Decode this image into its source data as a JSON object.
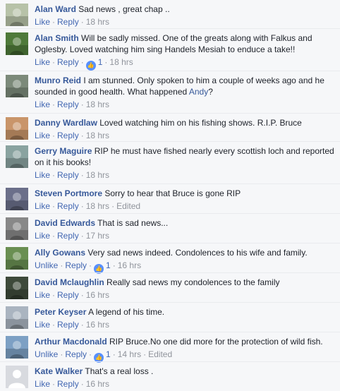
{
  "separator": "·",
  "like_icon_glyph": "👍",
  "comments": [
    {
      "name": "Alan Ward",
      "text": "Sad news , great chap ..",
      "action": "Like",
      "reply": "Reply",
      "time": "18 hrs",
      "reactions": null,
      "edited": null,
      "avatar": "fish-photo",
      "accent": "#b7c2a8"
    },
    {
      "name": "Alan Smith",
      "text": "Will be sadly missed. One of the greats along with Falkus and Oglesby. Loved watching him sing Handels Mesiah to enduce a take!!",
      "action": "Like",
      "reply": "Reply",
      "time": "18 hrs",
      "reactions": "1",
      "edited": null,
      "avatar": "landscape-photo",
      "accent": "#4f7a3a"
    },
    {
      "name": "Munro Reid",
      "text": "I am stunned. Only spoken to him a couple of weeks ago and he sounded in good health. What happened ",
      "mention": "Andy",
      "text_end": "?",
      "action": "Like",
      "reply": "Reply",
      "time": "18 hrs",
      "reactions": null,
      "edited": null,
      "avatar": "fishing-photo",
      "accent": "#7c8a7a"
    },
    {
      "name": "Danny Wardlaw",
      "text": "Loved watching him on his fishing shows. R.I.P. Bruce",
      "action": "Like",
      "reply": "Reply",
      "time": "18 hrs",
      "reactions": null,
      "edited": null,
      "avatar": "face-photo",
      "accent": "#c9956a"
    },
    {
      "name": "Gerry Maguire",
      "text": "RIP he must have fished nearly every scottish loch and reported on it his books!",
      "action": "Like",
      "reply": "Reply",
      "time": "18 hrs",
      "reactions": null,
      "edited": null,
      "avatar": "water-photo",
      "accent": "#8aa3a0"
    },
    {
      "name": "Steven Portmore",
      "text": "Sorry to hear that Bruce is gone RIP",
      "action": "Like",
      "reply": "Reply",
      "time": "18 hrs",
      "reactions": null,
      "edited": "Edited",
      "avatar": "group-photo",
      "accent": "#6b6f8a"
    },
    {
      "name": "David Edwards",
      "text": "That is sad news...",
      "action": "Like",
      "reply": "Reply",
      "time": "17 hrs",
      "reactions": null,
      "edited": null,
      "avatar": "bw-portrait",
      "accent": "#888888"
    },
    {
      "name": "Ally Gowans",
      "text": "Very sad news indeed. Condolences to his wife and family.",
      "action": "Unlike",
      "reply": "Reply",
      "time": "16 hrs",
      "reactions": "1",
      "edited": null,
      "avatar": "outdoor-portrait",
      "accent": "#6a8f52"
    },
    {
      "name": "David Mclaughlin",
      "text": "Really sad news my condolences to the family",
      "action": "Like",
      "reply": "Reply",
      "time": "16 hrs",
      "reactions": null,
      "edited": null,
      "avatar": "dark-photo",
      "accent": "#3e4a3a"
    },
    {
      "name": "Peter Keyser",
      "text": "A legend of his time.",
      "action": "Like",
      "reply": "Reply",
      "time": "16 hrs",
      "reactions": null,
      "edited": null,
      "avatar": "snow-photo",
      "accent": "#aab4c0"
    },
    {
      "name": "Arthur Macdonald",
      "text": "RIP Bruce.No one did more for the protection of wild fish.",
      "action": "Unlike",
      "reply": "Reply",
      "time": "14 hrs",
      "reactions": "1",
      "edited": "Edited",
      "avatar": "sky-portrait",
      "accent": "#7da0c4"
    },
    {
      "name": "Kate Walker",
      "text": "That's a real loss .",
      "action": "Like",
      "reply": "Reply",
      "time": "16 hrs",
      "reactions": null,
      "edited": null,
      "avatar": "default-silhouette",
      "accent": "#d0d1d5"
    }
  ]
}
